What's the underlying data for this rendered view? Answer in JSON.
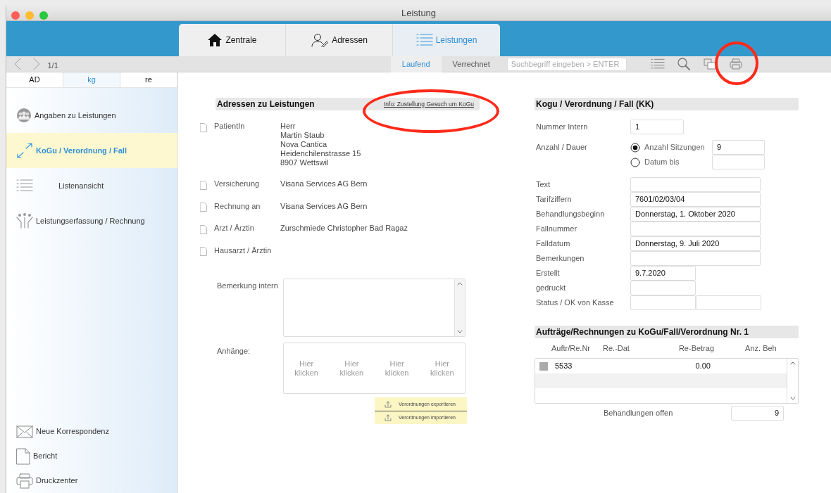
{
  "window": {
    "title": "Leistung"
  },
  "top_tabs": [
    {
      "label": "Zentrale",
      "selected": false
    },
    {
      "label": "Adressen",
      "selected": false
    },
    {
      "label": "Leistungen",
      "selected": true
    }
  ],
  "toolbar": {
    "page": "1/1",
    "filter_tabs": [
      {
        "label": "Laufend",
        "selected": true
      },
      {
        "label": "Verrechnet",
        "selected": false
      }
    ],
    "search": {
      "placeholder": "Suchbegriff eingeben > ENTER"
    },
    "tools": [
      {
        "kind": "list",
        "highlighted": false
      },
      {
        "kind": "search",
        "highlighted": false
      },
      {
        "kind": "copy",
        "highlighted": false
      },
      {
        "kind": "print",
        "highlighted": true
      }
    ]
  },
  "sidebar": {
    "tabs": [
      {
        "label": "AD",
        "selected": false
      },
      {
        "label": "kg",
        "selected": true
      },
      {
        "label": "re",
        "selected": false
      }
    ],
    "items": [
      {
        "label": "Angaben zu Leistungen",
        "selected": false
      },
      {
        "label": "KoGu / Verordnung / Fall",
        "selected": true
      },
      {
        "label": "Listenansicht",
        "selected": false
      },
      {
        "label": "Leistungserfassung / Rechnung",
        "selected": false
      }
    ],
    "bottom_items": [
      {
        "label": "Neue Korrespondenz"
      },
      {
        "label": "Bericht"
      },
      {
        "label": "Druckzenter"
      }
    ]
  },
  "addresses": {
    "title": "Adressen zu Leistungen",
    "info_link": {
      "label": "Info: Zustellung Gesuch um KoGu",
      "highlighted": true
    },
    "rows": [
      {
        "label": "PatientIn",
        "lines": [
          "Herr",
          "Martin Staub",
          "Nova Cantica",
          "Heidenchilenstrasse 15",
          "8907 Wettswil"
        ]
      },
      {
        "label": "Versicherung",
        "lines": [
          "Visana Services AG Bern"
        ]
      },
      {
        "label": "Rechnung an",
        "lines": [
          "Visana Services AG Bern"
        ]
      },
      {
        "label": "Arzt / Ärztin",
        "lines": [
          "Zurschmiede Christopher Bad Ragaz"
        ]
      },
      {
        "label": "Hausarzt / Ärztin",
        "lines": []
      }
    ],
    "remark_label": "Bemerkung intern",
    "attachments_label": "Anhänge:",
    "attachment_slots": [
      "Hier klicken",
      "Hier klicken",
      "Hier klicken",
      "Hier klicken"
    ],
    "buttons": [
      "Verordnungen exportieren",
      "Verordnungen importieren"
    ]
  },
  "kogu": {
    "title": "Kogu / Verordnung / Fall (KK)",
    "fields": [
      {
        "kind": "short",
        "label": "Nummer Intern",
        "value": "1"
      },
      {
        "kind": "radio",
        "label": "Anzahl / Dauer",
        "options": [
          {
            "label": "Anzahl Sitzungen",
            "selected": true,
            "value": "9"
          },
          {
            "label": "Datum bis",
            "selected": false
          }
        ]
      },
      {
        "kind": "wide",
        "label": "Text"
      },
      {
        "kind": "wide",
        "label": "Tarifziffern",
        "value": "7601/02/03/04"
      },
      {
        "kind": "wide",
        "label": "Behandlungsbeginn",
        "value": "Donnerstag, 1. Oktober 2020"
      },
      {
        "kind": "wide",
        "label": "Fallnummer"
      },
      {
        "kind": "wide",
        "label": "Falldatum",
        "value": "Donnerstag, 9. Juli 2020"
      },
      {
        "kind": "wide",
        "label": "Bemerkungen"
      },
      {
        "kind": "medium",
        "label": "Erstellt",
        "value": "9.7.2020"
      },
      {
        "kind": "medium",
        "label": "gedruckt"
      },
      {
        "kind": "double",
        "label": "Status / OK von Kasse"
      }
    ]
  },
  "orders": {
    "title": "Aufträge/Rechnungen zu KoGu/Fall/Verordnung Nr. 1",
    "columns": [
      "Auftr/Re.Nr",
      "Re.-Dat",
      "Re-Betrag",
      "Anz. Beh"
    ],
    "rows": [
      {
        "cells": [
          "5533",
          "",
          "0.00",
          ""
        ]
      }
    ],
    "open_label": "Behandlungen offen",
    "open_value": "9"
  }
}
